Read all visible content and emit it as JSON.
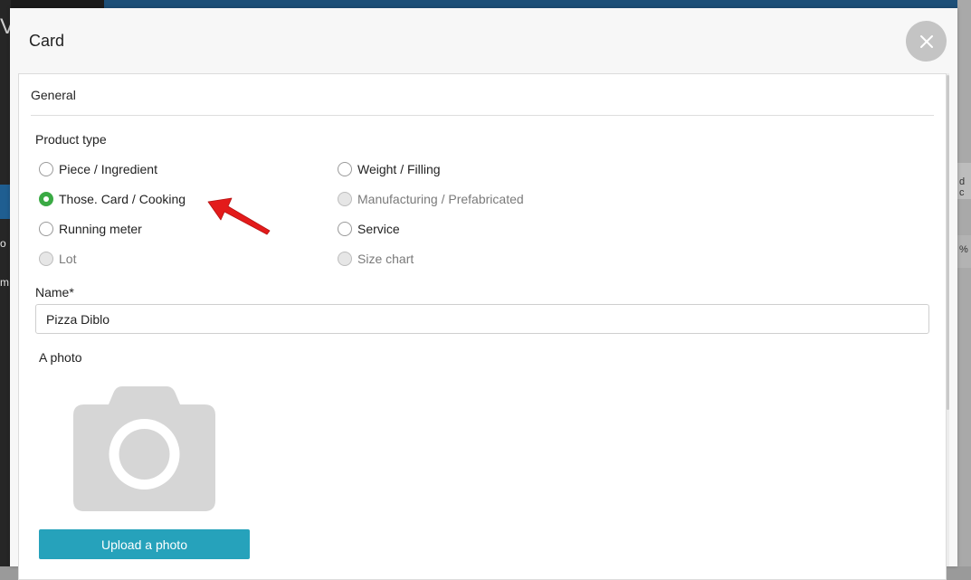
{
  "modal": {
    "title": "Card"
  },
  "general": {
    "section_title": "General",
    "product_type_label": "Product type",
    "options": [
      {
        "label": "Piece / Ingredient",
        "checked": false,
        "disabled": false
      },
      {
        "label": "Weight / Filling",
        "checked": false,
        "disabled": false
      },
      {
        "label": "Those. Card / Cooking",
        "checked": true,
        "disabled": false
      },
      {
        "label": "Manufacturing / Prefabricated",
        "checked": false,
        "disabled": true
      },
      {
        "label": "Running meter",
        "checked": false,
        "disabled": false
      },
      {
        "label": "Service",
        "checked": false,
        "disabled": false
      },
      {
        "label": "Lot",
        "checked": false,
        "disabled": true
      },
      {
        "label": "Size chart",
        "checked": false,
        "disabled": true
      }
    ],
    "name_label": "Name*",
    "name_value": "Pizza Diblo",
    "photo_label": "A photo",
    "upload_button": "Upload a photo"
  },
  "background": {
    "logo_fragment": "V",
    "left_text_1": "o",
    "left_text_2": "m",
    "right_text_1": "d c",
    "right_text_2": "%"
  },
  "icons": {
    "close": "close-icon",
    "camera": "camera-icon",
    "annotation": "red-arrow-icon"
  },
  "colors": {
    "accent_green": "#3aaa44",
    "upload_button": "#26a2bb",
    "arrow_red": "#e31b1b"
  }
}
